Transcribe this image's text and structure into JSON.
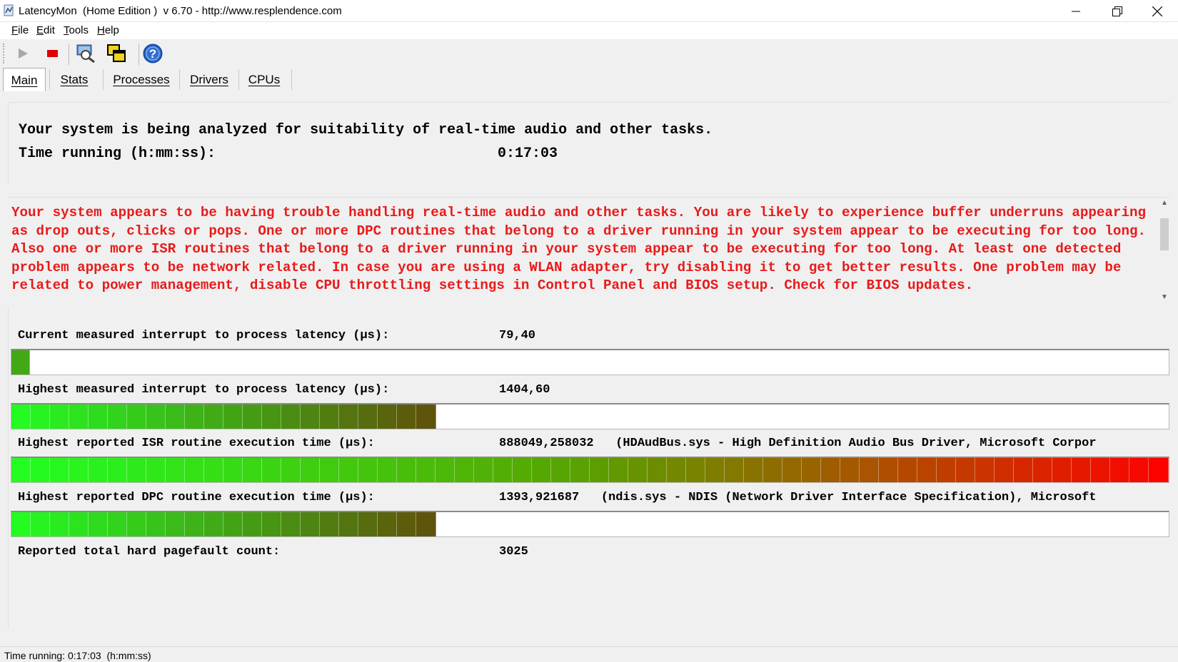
{
  "window": {
    "title": "LatencyMon  (Home Edition )  v 6.70 - http://www.resplendence.com"
  },
  "menu": {
    "items": [
      {
        "label": "File",
        "underline": "F"
      },
      {
        "label": "Edit",
        "underline": "E"
      },
      {
        "label": "Tools",
        "underline": "T"
      },
      {
        "label": "Help",
        "underline": "H"
      }
    ]
  },
  "toolbar": {
    "icons": [
      "play-icon",
      "stop-icon",
      "search-icon",
      "windows-icon",
      "help-icon"
    ]
  },
  "tabs": [
    {
      "label": "Main",
      "active": true
    },
    {
      "label": "Stats",
      "active": false
    },
    {
      "label": "Processes",
      "active": false
    },
    {
      "label": "Drivers",
      "active": false
    },
    {
      "label": "CPUs",
      "active": false
    }
  ],
  "analysis": {
    "heading": "Your system is being analyzed for suitability of real-time audio and other tasks.",
    "time_label": "Time running (h:mm:ss):",
    "time_value": "0:17:03"
  },
  "warning": {
    "text": "Your system appears to be having trouble handling real-time audio and other tasks. You are likely to experience buffer underruns appearing as drop outs, clicks or pops. One or more DPC routines that belong to a driver running in your system appear to be executing for too long. Also one or more ISR routines that belong to a driver running in your system appear to be executing for too long. At least one detected problem appears to be network related. In case you are using a WLAN adapter, try disabling it to get better results. One problem may be related to power management, disable CPU throttling settings in Control Panel and BIOS setup. Check for BIOS updates.",
    "color": "#e81a1a"
  },
  "metrics": [
    {
      "label": "Current measured interrupt to process latency (µs):",
      "value": "79,40",
      "bar_fraction": 0.016
    },
    {
      "label": "Highest measured interrupt to process latency (µs):",
      "value": "1404,60",
      "bar_fraction": 0.367
    },
    {
      "label": "Highest reported ISR routine execution time (µs):",
      "value": "888049,258032   (HDAudBus.sys - High Definition Audio Bus Driver, Microsoft Corpor",
      "bar_fraction": 1.0
    },
    {
      "label": "Highest reported DPC routine execution time (µs):",
      "value": "1393,921687   (ndis.sys - NDIS (Network Driver Interface Specification), Microsoft",
      "bar_fraction": 0.367
    },
    {
      "label": "Reported total hard pagefault count:",
      "value": "3025"
    }
  ],
  "status": {
    "text": "Time running: 0:17:03  (h:mm:ss)"
  },
  "colors": {
    "bar_start": "#22ff22",
    "bar_mid": "#5aa000",
    "bar_end": "#ff0000",
    "warning_text": "#e81a1a"
  }
}
